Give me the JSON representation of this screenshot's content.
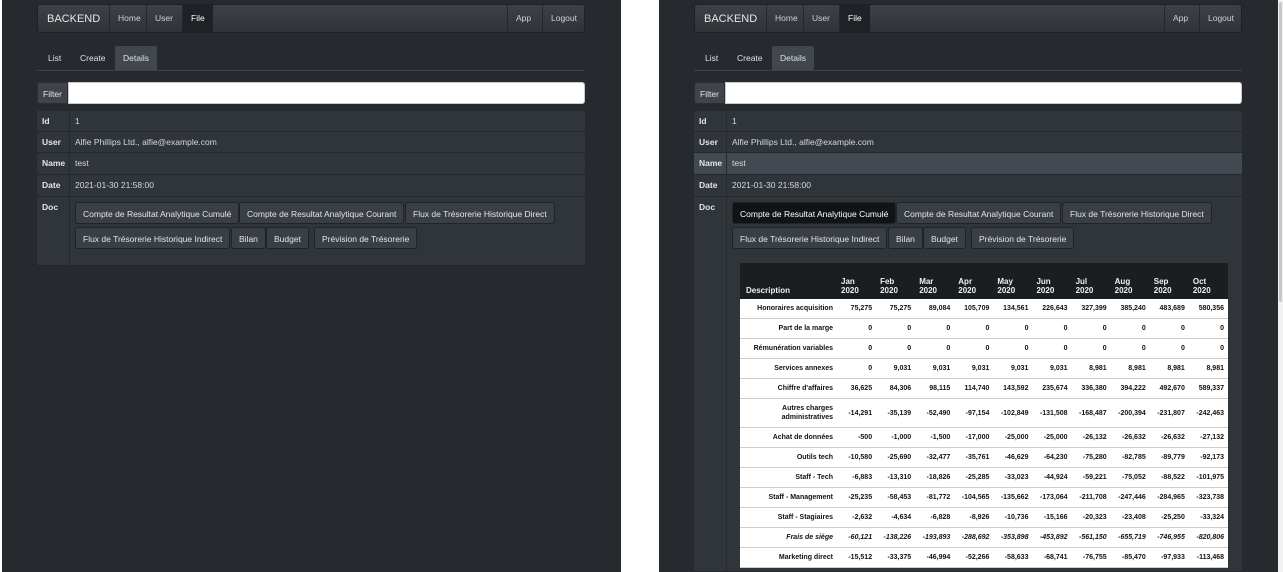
{
  "navbar": {
    "brand": "BACKEND",
    "items": [
      "Home",
      "User",
      "File"
    ],
    "right_items": [
      "App",
      "Logout"
    ]
  },
  "tabs": [
    "List",
    "Create",
    "Details"
  ],
  "filter": {
    "label": "Filter",
    "value": ""
  },
  "details": {
    "id": {
      "label": "Id",
      "value": "1"
    },
    "user": {
      "label": "User",
      "value": "Alfie Phillips Ltd., alfie@example.com"
    },
    "name": {
      "label": "Name",
      "value": "test"
    },
    "date": {
      "label": "Date",
      "value": "2021-01-30 21:58:00"
    },
    "doc": {
      "label": "Doc"
    }
  },
  "doc_buttons": [
    "Compte de Resultat Analytique Cumulé",
    "Compte de Resultat Analytique Courant",
    "Flux de Trésorerie Historique Direct",
    "Flux de Trésorerie Historique Indirect",
    "Bilan",
    "Budget",
    "Prévision de Trésorerie"
  ],
  "table": {
    "description_header": "Description",
    "months": [
      "Jan",
      "Feb",
      "Mar",
      "Apr",
      "May",
      "Jun",
      "Jul",
      "Aug",
      "Sep",
      "Oct"
    ],
    "year": "2020",
    "rows": [
      {
        "label": "Honoraires acquisition",
        "values": [
          "75,275",
          "75,275",
          "89,084",
          "105,709",
          "134,561",
          "226,643",
          "327,399",
          "385,240",
          "483,689",
          "580,356"
        ]
      },
      {
        "label": "Part de la marge",
        "values": [
          "0",
          "0",
          "0",
          "0",
          "0",
          "0",
          "0",
          "0",
          "0",
          "0"
        ]
      },
      {
        "label": "Rémunération variables",
        "values": [
          "0",
          "0",
          "0",
          "0",
          "0",
          "0",
          "0",
          "0",
          "0",
          "0"
        ]
      },
      {
        "label": "Services annexes",
        "values": [
          "0",
          "9,031",
          "9,031",
          "9,031",
          "9,031",
          "9,031",
          "8,981",
          "8,981",
          "8,981",
          "8,981"
        ]
      },
      {
        "label": "Chiffre d'affaires",
        "values": [
          "36,625",
          "84,306",
          "98,115",
          "114,740",
          "143,592",
          "235,674",
          "336,380",
          "394,222",
          "492,670",
          "589,337"
        ]
      },
      {
        "label": "Autres charges administratives",
        "values": [
          "-14,291",
          "-35,139",
          "-52,490",
          "-97,154",
          "-102,849",
          "-131,508",
          "-168,487",
          "-200,394",
          "-231,807",
          "-242,463"
        ]
      },
      {
        "label": "Achat de données",
        "values": [
          "-500",
          "-1,000",
          "-1,500",
          "-17,000",
          "-25,000",
          "-25,000",
          "-26,132",
          "-26,632",
          "-26,632",
          "-27,132"
        ]
      },
      {
        "label": "Outils tech",
        "values": [
          "-10,580",
          "-25,690",
          "-32,477",
          "-35,761",
          "-46,629",
          "-64,230",
          "-75,280",
          "-82,785",
          "-89,779",
          "-92,173"
        ]
      },
      {
        "label": "Staff - Tech",
        "values": [
          "-6,883",
          "-13,310",
          "-18,826",
          "-25,285",
          "-33,023",
          "-44,924",
          "-59,221",
          "-75,052",
          "-88,522",
          "-101,975"
        ]
      },
      {
        "label": "Staff - Management",
        "values": [
          "-25,235",
          "-58,453",
          "-81,772",
          "-104,565",
          "-135,662",
          "-173,064",
          "-211,708",
          "-247,446",
          "-284,965",
          "-323,738"
        ]
      },
      {
        "label": "Staff - Stagiaires",
        "values": [
          "-2,632",
          "-4,634",
          "-6,828",
          "-8,926",
          "-10,736",
          "-15,166",
          "-20,323",
          "-23,408",
          "-25,250",
          "-33,324"
        ]
      },
      {
        "label": "Frais de siège",
        "values": [
          "-60,121",
          "-138,226",
          "-193,893",
          "-288,692",
          "-353,898",
          "-453,892",
          "-561,150",
          "-655,719",
          "-746,955",
          "-820,806"
        ]
      },
      {
        "label": "Marketing direct",
        "values": [
          "-15,512",
          "-33,375",
          "-46,994",
          "-52,266",
          "-58,633",
          "-68,741",
          "-76,755",
          "-85,470",
          "-97,933",
          "-113,468"
        ]
      }
    ]
  }
}
